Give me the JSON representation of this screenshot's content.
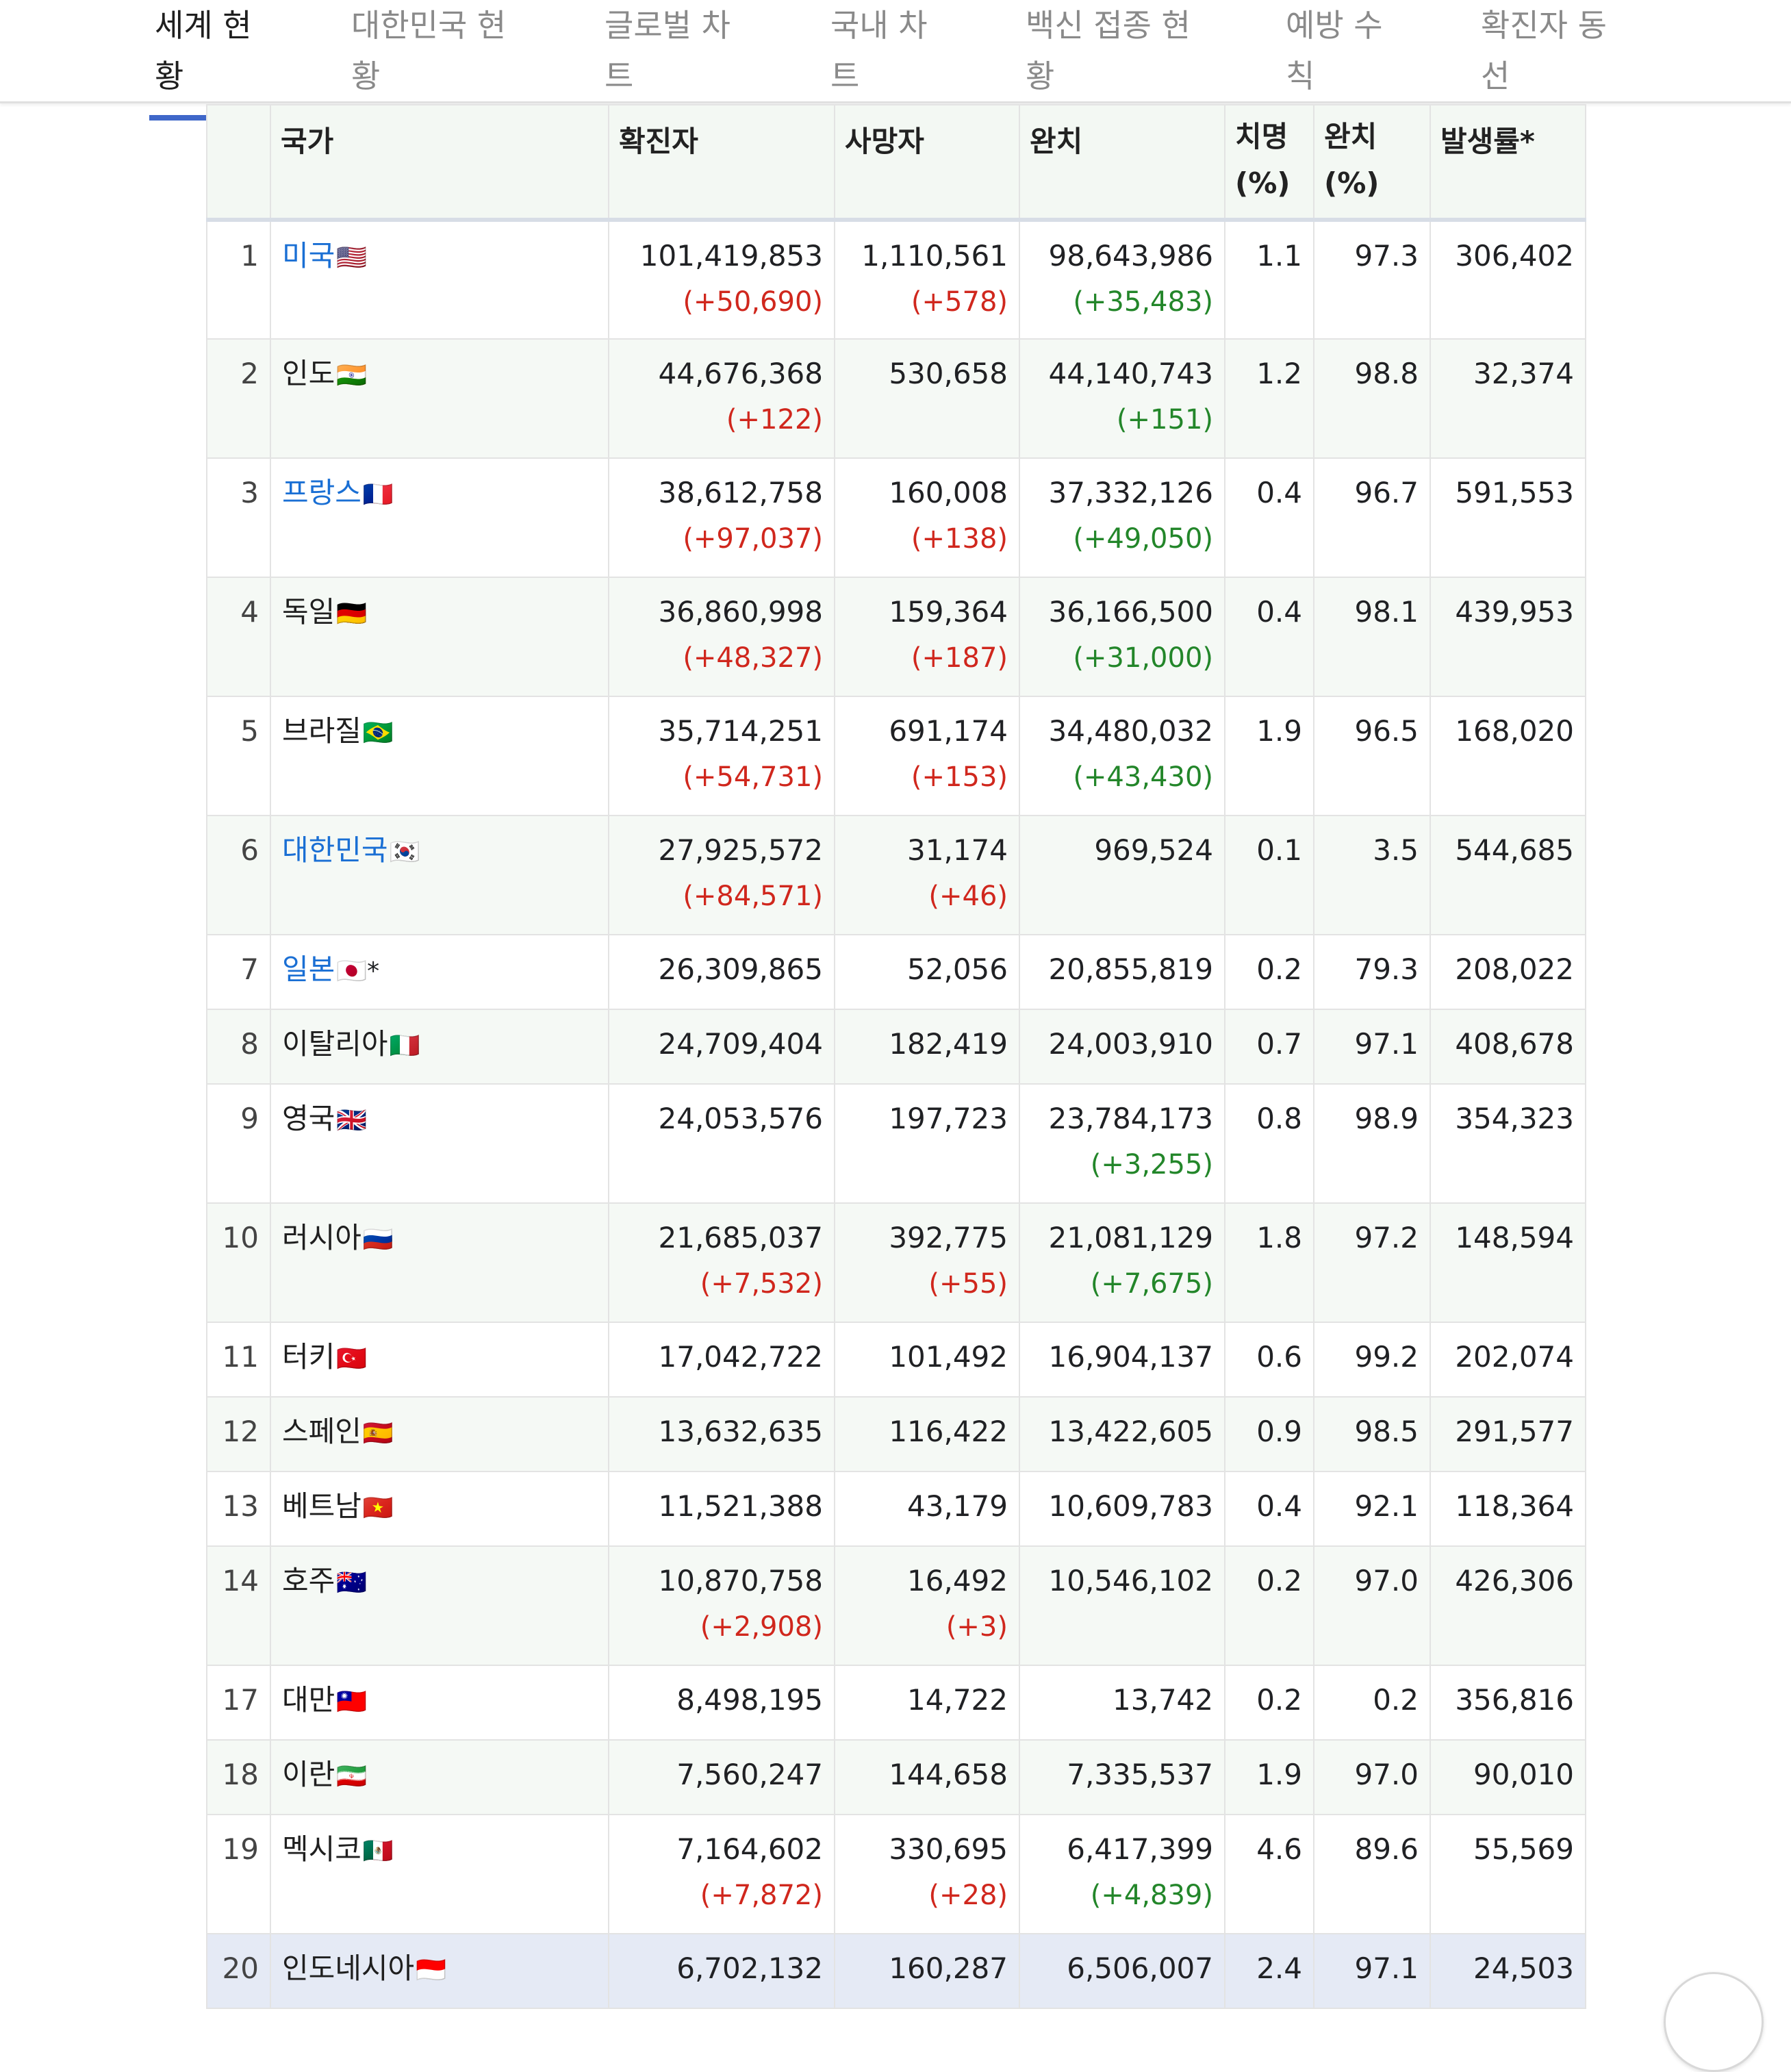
{
  "tabs": [
    {
      "label": "세계 현황",
      "active": true
    },
    {
      "label": "대한민국 현황",
      "active": false
    },
    {
      "label": "글로벌 차트",
      "active": false
    },
    {
      "label": "국내 차트",
      "active": false
    },
    {
      "label": "백신 접종 현황",
      "active": false
    },
    {
      "label": "예방 수칙",
      "active": false
    },
    {
      "label": "확진자 동선",
      "active": false
    }
  ],
  "table": {
    "headers": {
      "rank": "",
      "country": "국가",
      "confirmed": "확진자",
      "deaths": "사망자",
      "recovered": "완치",
      "fatality_line1": "치명",
      "fatality_line2": "(%)",
      "recovery_line1": "완치",
      "recovery_line2": "(%)",
      "incidence": "발생률*"
    },
    "rows": [
      {
        "rank": "1",
        "country": "미국",
        "flag": "🇺🇸",
        "link": true,
        "confirmed": "101,419,853",
        "confirmed_delta": "(+50,690)",
        "deaths": "1,110,561",
        "deaths_delta": "(+578)",
        "recovered": "98,643,986",
        "recovered_delta": "(+35,483)",
        "fatality": "1.1",
        "recovery": "97.3",
        "incidence": "306,402"
      },
      {
        "rank": "2",
        "country": "인도",
        "flag": "🇮🇳",
        "link": false,
        "confirmed": "44,676,368",
        "confirmed_delta": "(+122)",
        "deaths": "530,658",
        "deaths_delta": "",
        "recovered": "44,140,743",
        "recovered_delta": "(+151)",
        "fatality": "1.2",
        "recovery": "98.8",
        "incidence": "32,374"
      },
      {
        "rank": "3",
        "country": "프랑스",
        "flag": "🇫🇷",
        "link": true,
        "confirmed": "38,612,758",
        "confirmed_delta": "(+97,037)",
        "deaths": "160,008",
        "deaths_delta": "(+138)",
        "recovered": "37,332,126",
        "recovered_delta": "(+49,050)",
        "fatality": "0.4",
        "recovery": "96.7",
        "incidence": "591,553"
      },
      {
        "rank": "4",
        "country": "독일",
        "flag": "🇩🇪",
        "link": false,
        "confirmed": "36,860,998",
        "confirmed_delta": "(+48,327)",
        "deaths": "159,364",
        "deaths_delta": "(+187)",
        "recovered": "36,166,500",
        "recovered_delta": "(+31,000)",
        "fatality": "0.4",
        "recovery": "98.1",
        "incidence": "439,953"
      },
      {
        "rank": "5",
        "country": "브라질",
        "flag": "🇧🇷",
        "link": false,
        "confirmed": "35,714,251",
        "confirmed_delta": "(+54,731)",
        "deaths": "691,174",
        "deaths_delta": "(+153)",
        "recovered": "34,480,032",
        "recovered_delta": "(+43,430)",
        "fatality": "1.9",
        "recovery": "96.5",
        "incidence": "168,020"
      },
      {
        "rank": "6",
        "country": "대한민국",
        "flag": "🇰🇷",
        "link": true,
        "confirmed": "27,925,572",
        "confirmed_delta": "(+84,571)",
        "deaths": "31,174",
        "deaths_delta": "(+46)",
        "recovered": "969,524",
        "recovered_delta": "",
        "fatality": "0.1",
        "recovery": "3.5",
        "incidence": "544,685"
      },
      {
        "rank": "7",
        "country": "일본",
        "flag": "🇯🇵*",
        "link": true,
        "confirmed": "26,309,865",
        "confirmed_delta": "",
        "deaths": "52,056",
        "deaths_delta": "",
        "recovered": "20,855,819",
        "recovered_delta": "",
        "fatality": "0.2",
        "recovery": "79.3",
        "incidence": "208,022"
      },
      {
        "rank": "8",
        "country": "이탈리아",
        "flag": "🇮🇹",
        "link": false,
        "confirmed": "24,709,404",
        "confirmed_delta": "",
        "deaths": "182,419",
        "deaths_delta": "",
        "recovered": "24,003,910",
        "recovered_delta": "",
        "fatality": "0.7",
        "recovery": "97.1",
        "incidence": "408,678"
      },
      {
        "rank": "9",
        "country": "영국",
        "flag": "🇬🇧",
        "link": false,
        "confirmed": "24,053,576",
        "confirmed_delta": "",
        "deaths": "197,723",
        "deaths_delta": "",
        "recovered": "23,784,173",
        "recovered_delta": "(+3,255)",
        "fatality": "0.8",
        "recovery": "98.9",
        "incidence": "354,323"
      },
      {
        "rank": "10",
        "country": "러시아",
        "flag": "🇷🇺",
        "link": false,
        "confirmed": "21,685,037",
        "confirmed_delta": "(+7,532)",
        "deaths": "392,775",
        "deaths_delta": "(+55)",
        "recovered": "21,081,129",
        "recovered_delta": "(+7,675)",
        "fatality": "1.8",
        "recovery": "97.2",
        "incidence": "148,594"
      },
      {
        "rank": "11",
        "country": "터키",
        "flag": "🇹🇷",
        "link": false,
        "confirmed": "17,042,722",
        "confirmed_delta": "",
        "deaths": "101,492",
        "deaths_delta": "",
        "recovered": "16,904,137",
        "recovered_delta": "",
        "fatality": "0.6",
        "recovery": "99.2",
        "incidence": "202,074"
      },
      {
        "rank": "12",
        "country": "스페인",
        "flag": "🇪🇸",
        "link": false,
        "confirmed": "13,632,635",
        "confirmed_delta": "",
        "deaths": "116,422",
        "deaths_delta": "",
        "recovered": "13,422,605",
        "recovered_delta": "",
        "fatality": "0.9",
        "recovery": "98.5",
        "incidence": "291,577"
      },
      {
        "rank": "13",
        "country": "베트남",
        "flag": "🇻🇳",
        "link": false,
        "confirmed": "11,521,388",
        "confirmed_delta": "",
        "deaths": "43,179",
        "deaths_delta": "",
        "recovered": "10,609,783",
        "recovered_delta": "",
        "fatality": "0.4",
        "recovery": "92.1",
        "incidence": "118,364"
      },
      {
        "rank": "14",
        "country": "호주",
        "flag": "🇦🇺",
        "link": false,
        "confirmed": "10,870,758",
        "confirmed_delta": "(+2,908)",
        "deaths": "16,492",
        "deaths_delta": "(+3)",
        "recovered": "10,546,102",
        "recovered_delta": "",
        "fatality": "0.2",
        "recovery": "97.0",
        "incidence": "426,306"
      },
      {
        "rank": "17",
        "country": "대만",
        "flag": "🇹🇼",
        "link": false,
        "confirmed": "8,498,195",
        "confirmed_delta": "",
        "deaths": "14,722",
        "deaths_delta": "",
        "recovered": "13,742",
        "recovered_delta": "",
        "fatality": "0.2",
        "recovery": "0.2",
        "incidence": "356,816"
      },
      {
        "rank": "18",
        "country": "이란",
        "flag": "🇮🇷",
        "link": false,
        "confirmed": "7,560,247",
        "confirmed_delta": "",
        "deaths": "144,658",
        "deaths_delta": "",
        "recovered": "7,335,537",
        "recovered_delta": "",
        "fatality": "1.9",
        "recovery": "97.0",
        "incidence": "90,010"
      },
      {
        "rank": "19",
        "country": "멕시코",
        "flag": "🇲🇽",
        "link": false,
        "confirmed": "7,164,602",
        "confirmed_delta": "(+7,872)",
        "deaths": "330,695",
        "deaths_delta": "(+28)",
        "recovered": "6,417,399",
        "recovered_delta": "(+4,839)",
        "fatality": "4.6",
        "recovery": "89.6",
        "incidence": "55,569"
      },
      {
        "rank": "20",
        "country": "인도네시아",
        "flag": "🇮🇩",
        "link": false,
        "confirmed": "6,702,132",
        "confirmed_delta": "",
        "deaths": "160,287",
        "deaths_delta": "",
        "recovered": "6,506,007",
        "recovered_delta": "",
        "fatality": "2.4",
        "recovery": "97.1",
        "incidence": "24,503"
      }
    ]
  },
  "colors": {
    "link": "#1a6fd4",
    "increase_red": "#d0271d",
    "increase_green": "#23862a",
    "tab_indicator": "#3f67c9",
    "header_bg": "#f3f8f3",
    "highlight_row": "#e5eaf5"
  }
}
